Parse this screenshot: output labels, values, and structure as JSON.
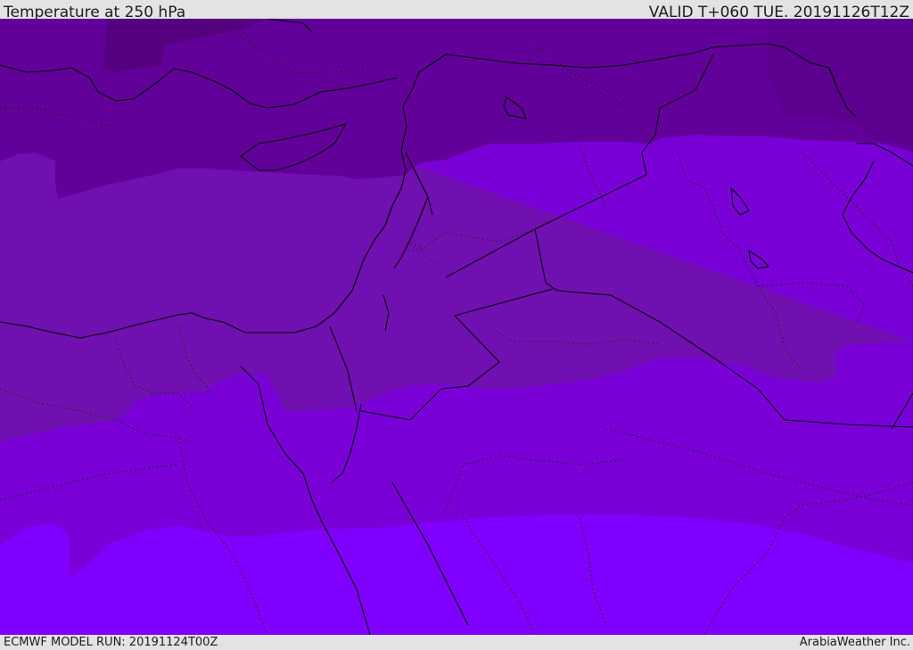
{
  "header": {
    "title": "Temperature at 250 hPa",
    "valid": "VALID T+060 TUE. 20191126T12Z"
  },
  "footer": {
    "model_run": "ECMWF MODEL RUN: 20191124T00Z",
    "credit": "ArabiaWeather Inc."
  },
  "map": {
    "field": "temperature",
    "level": "250 hPa",
    "palette": [
      "#55007f",
      "#62009a",
      "#7010b0",
      "#7a00d8",
      "#8000ff"
    ],
    "coastline_color": "#000000",
    "border_style": "dotted"
  }
}
